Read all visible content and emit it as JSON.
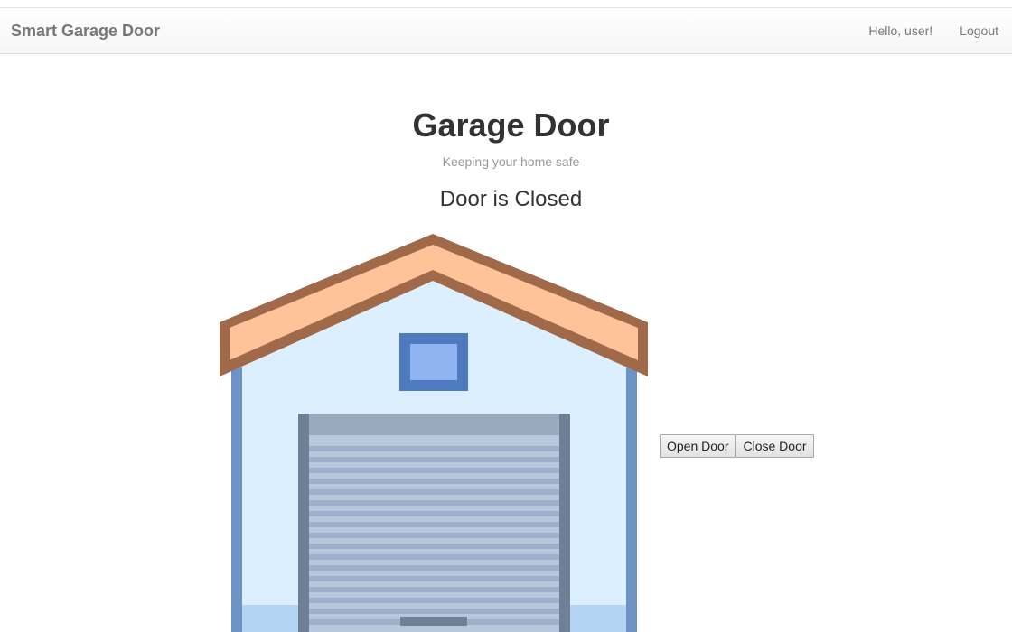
{
  "navbar": {
    "brand": "Smart Garage Door",
    "greeting": "Hello, user!",
    "logout": "Logout"
  },
  "main": {
    "title": "Garage Door",
    "subtitle": "Keeping your home safe",
    "status": "Door is Closed"
  },
  "controls": {
    "open_label": "Open Door",
    "close_label": "Close Door"
  },
  "illustration": {
    "icon": "garage-icon",
    "door_state": "closed",
    "colors": {
      "roof_fill": "#ffc39a",
      "roof_outline": "#a0694a",
      "wall": "#dcefff",
      "wall_edge": "#6c93c4",
      "window_frame": "#4e7bbf",
      "window_glass": "#8fb4ef",
      "door_frame": "#6e7f96",
      "door_slat": "#b8c7dc",
      "door_slat_dark": "#9fb1ca"
    }
  }
}
